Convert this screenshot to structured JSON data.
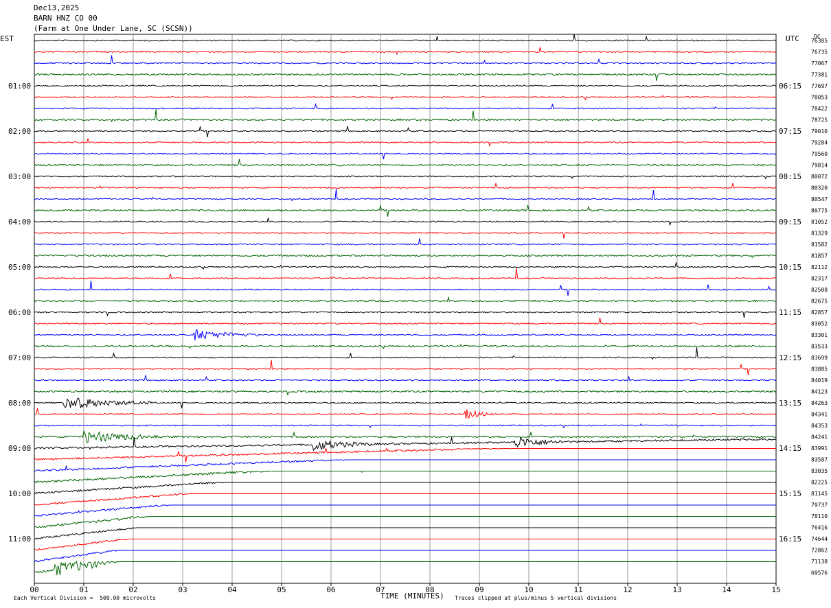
{
  "header": {
    "date": "Dec13,2025",
    "channel": "BARN HNZ CO 00",
    "location": "(Farm at One Under Lane, SC (SCSN))"
  },
  "tz_left": "EST",
  "tz_right": "UTC",
  "dc_label": "DC",
  "footer": {
    "scale": "Each Vertical Division =  500.00 microvolts",
    "clip": "Traces clipped at plus/minus 5 vertical divisions",
    "xlabel": "TIME (MINUTES)"
  },
  "colors": {
    "cycle": [
      "#000000",
      "#ff0000",
      "#0000ff",
      "#006400"
    ],
    "grid": "#808080"
  },
  "chart_data": {
    "type": "line",
    "title": "",
    "xlabel": "TIME (MINUTES)",
    "x_ticks": [
      "00",
      "01",
      "02",
      "03",
      "04",
      "05",
      "06",
      "07",
      "08",
      "09",
      "10",
      "11",
      "12",
      "13",
      "14",
      "15"
    ],
    "xlim": [
      0,
      15
    ],
    "rows": 48,
    "left_time_labels": [
      {
        "row": 4,
        "label": "01:00"
      },
      {
        "row": 8,
        "label": "02:00"
      },
      {
        "row": 12,
        "label": "03:00"
      },
      {
        "row": 16,
        "label": "04:00"
      },
      {
        "row": 20,
        "label": "05:00"
      },
      {
        "row": 24,
        "label": "06:00"
      },
      {
        "row": 28,
        "label": "07:00"
      },
      {
        "row": 32,
        "label": "08:00"
      },
      {
        "row": 36,
        "label": "09:00"
      },
      {
        "row": 40,
        "label": "10:00"
      },
      {
        "row": 44,
        "label": "11:00"
      }
    ],
    "right_time_labels": [
      {
        "row": 4,
        "label": "06:15"
      },
      {
        "row": 8,
        "label": "07:15"
      },
      {
        "row": 12,
        "label": "08:15"
      },
      {
        "row": 16,
        "label": "09:15"
      },
      {
        "row": 20,
        "label": "10:15"
      },
      {
        "row": 24,
        "label": "11:15"
      },
      {
        "row": 28,
        "label": "12:15"
      },
      {
        "row": 32,
        "label": "13:15"
      },
      {
        "row": 36,
        "label": "14:15"
      },
      {
        "row": 40,
        "label": "15:15"
      },
      {
        "row": 44,
        "label": "16:15"
      }
    ],
    "dc_offsets": [
      "76385",
      "76735",
      "77067",
      "77381",
      "77697",
      "78053",
      "78422",
      "78725",
      "79010",
      "79284",
      "79560",
      "79814",
      "80072",
      "80320",
      "80547",
      "80775",
      "81052",
      "81329",
      "81582",
      "81857",
      "82112",
      "82317",
      "82508",
      "82675",
      "82857",
      "83052",
      "83301",
      "83533",
      "83699",
      "83885",
      "84019",
      "84123",
      "84263",
      "84341",
      "84353",
      "84241",
      "83991",
      "83587",
      "83035",
      "82225",
      "81145",
      "79737",
      "78110",
      "76416",
      "74644",
      "72862",
      "71138",
      "69576"
    ],
    "events": [
      {
        "row": 32,
        "x": 0.6,
        "width": 1.8,
        "amp": 1.0
      },
      {
        "row": 35,
        "x": 1.0,
        "width": 1.6,
        "amp": 1.0
      },
      {
        "row": 36,
        "x": 5.6,
        "width": 1.2,
        "amp": 0.9
      },
      {
        "row": 36,
        "x": 9.7,
        "width": 1.0,
        "amp": 0.9
      },
      {
        "row": 37,
        "x": 13.7,
        "width": 0.8,
        "amp": 0.9
      },
      {
        "row": 38,
        "x": 13.0,
        "width": 1.4,
        "amp": 0.8
      },
      {
        "row": 39,
        "x": 8.7,
        "width": 0.9,
        "amp": 1.0
      },
      {
        "row": 42,
        "x": 8.1,
        "width": 1.2,
        "amp": 0.7
      },
      {
        "row": 45,
        "x": 9.6,
        "width": 1.6,
        "amp": 1.0
      },
      {
        "row": 47,
        "x": 0.4,
        "width": 2.2,
        "amp": 0.9
      },
      {
        "row": 26,
        "x": 3.2,
        "width": 1.4,
        "amp": 0.8
      },
      {
        "row": 33,
        "x": 8.7,
        "width": 0.6,
        "amp": 0.8
      },
      {
        "row": 41,
        "x": 10.9,
        "width": 1.2,
        "amp": 0.6
      }
    ]
  }
}
